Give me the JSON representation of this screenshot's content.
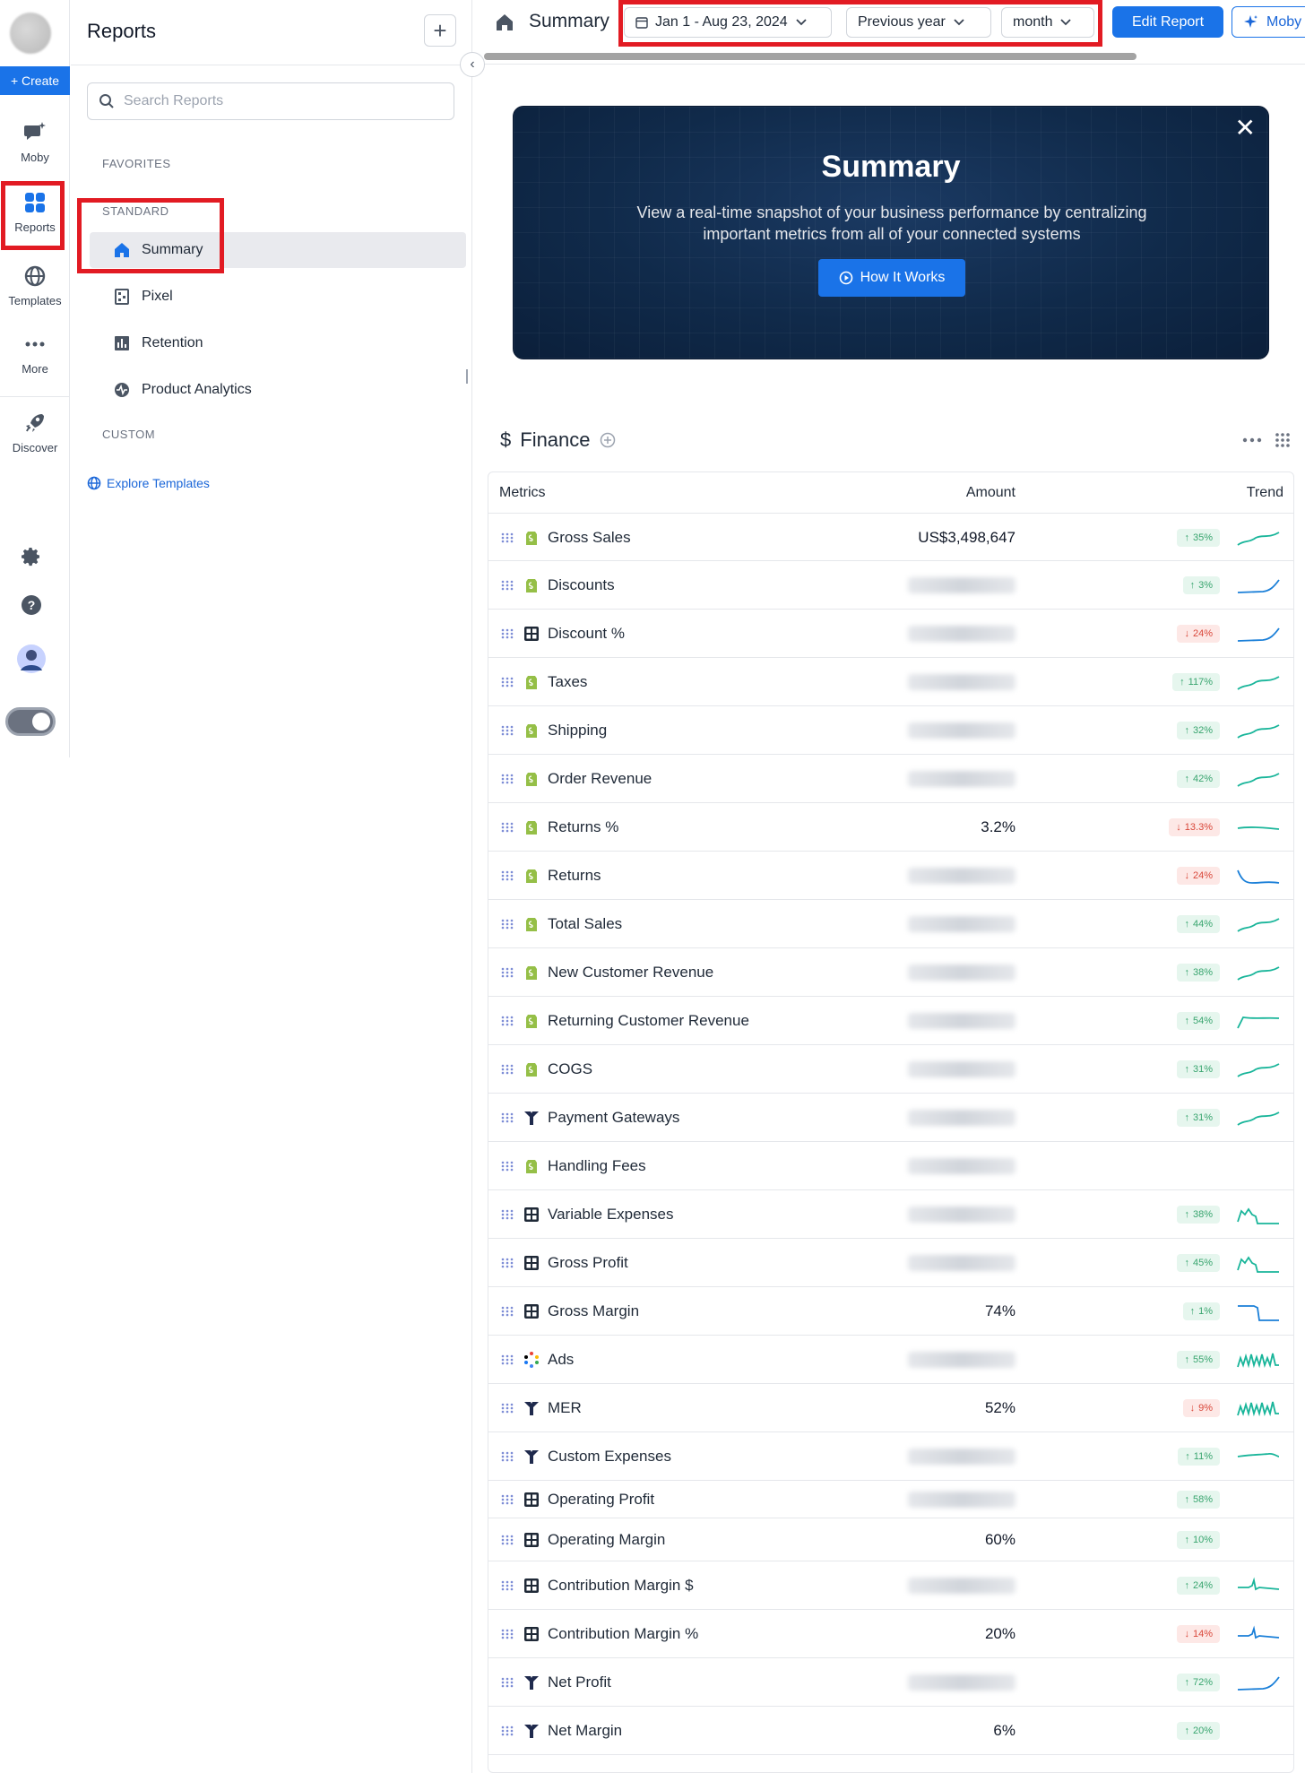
{
  "rail": {
    "create_label": "+ Create",
    "items": [
      {
        "label": "Moby",
        "icon": "moby-chat-icon"
      },
      {
        "label": "Reports",
        "icon": "reports-grid-icon"
      },
      {
        "label": "Templates",
        "icon": "globe-icon"
      },
      {
        "label": "More",
        "icon": "more-dots-icon"
      },
      {
        "label": "Discover",
        "icon": "rocket-icon"
      }
    ],
    "bottom_icons": [
      "settings-gear-icon",
      "help-icon",
      "user-avatar"
    ]
  },
  "panel": {
    "title": "Reports",
    "search_placeholder": "Search Reports",
    "favorites_label": "FAVORITES",
    "standard_label": "STANDARD",
    "custom_label": "CUSTOM",
    "items": [
      {
        "label": "Summary",
        "icon": "home-icon",
        "active": true
      },
      {
        "label": "Pixel",
        "icon": "pixel-icon",
        "active": false
      },
      {
        "label": "Retention",
        "icon": "bar-chart-icon",
        "active": false
      },
      {
        "label": "Product Analytics",
        "icon": "activity-icon",
        "active": false
      }
    ],
    "explore_label": "Explore Templates"
  },
  "header": {
    "title": "Summary",
    "date_range": "Jan 1 - Aug 23, 2024",
    "compare": "Previous year",
    "granularity": "month",
    "edit_label": "Edit Report",
    "moby_label": "Moby"
  },
  "banner": {
    "title": "Summary",
    "text": "View a real-time snapshot of your business performance by centralizing important metrics from all of your connected systems",
    "button_label": "How It Works"
  },
  "finance": {
    "title": "Finance",
    "columns": {
      "metrics": "Metrics",
      "amount": "Amount",
      "trend": "Trend"
    },
    "rows": [
      {
        "name": "Gross Sales",
        "source": "shopify",
        "amount": "US$3,498,647",
        "change": "35%",
        "dir": "up",
        "trend": "up-wave",
        "color": "#19b59a"
      },
      {
        "name": "Discounts",
        "source": "shopify",
        "amount": "",
        "change": "3%",
        "dir": "up",
        "trend": "rise-end",
        "color": "#1a7fd8"
      },
      {
        "name": "Discount %",
        "source": "calc",
        "amount": "",
        "change": "24%",
        "dir": "down",
        "trend": "rise-end",
        "color": "#1a7fd8"
      },
      {
        "name": "Taxes",
        "source": "shopify",
        "amount": "",
        "change": "117%",
        "dir": "up",
        "trend": "up-wave",
        "color": "#19b59a"
      },
      {
        "name": "Shipping",
        "source": "shopify",
        "amount": "",
        "change": "32%",
        "dir": "up",
        "trend": "up-wave",
        "color": "#19b59a"
      },
      {
        "name": "Order Revenue",
        "source": "shopify",
        "amount": "",
        "change": "42%",
        "dir": "up",
        "trend": "up-wave",
        "color": "#19b59a"
      },
      {
        "name": "Returns %",
        "source": "shopify",
        "amount": "3.2%",
        "change": "13.3%",
        "dir": "down",
        "trend": "flat",
        "color": "#19b59a"
      },
      {
        "name": "Returns",
        "source": "shopify",
        "amount": "",
        "change": "24%",
        "dir": "down",
        "trend": "drop",
        "color": "#1a7fd8"
      },
      {
        "name": "Total Sales",
        "source": "shopify",
        "amount": "",
        "change": "44%",
        "dir": "up",
        "trend": "up-wave",
        "color": "#19b59a"
      },
      {
        "name": "New Customer Revenue",
        "source": "shopify",
        "amount": "",
        "change": "38%",
        "dir": "up",
        "trend": "up-wave",
        "color": "#19b59a"
      },
      {
        "name": "Returning Customer Revenue",
        "source": "shopify",
        "amount": "",
        "change": "54%",
        "dir": "up",
        "trend": "jump-flat",
        "color": "#19b59a"
      },
      {
        "name": "COGS",
        "source": "shopify",
        "amount": "",
        "change": "31%",
        "dir": "up",
        "trend": "up-wave",
        "color": "#19b59a"
      },
      {
        "name": "Payment Gateways",
        "source": "triple",
        "amount": "",
        "change": "31%",
        "dir": "up",
        "trend": "up-wave",
        "color": "#19b59a"
      },
      {
        "name": "Handling Fees",
        "source": "shopify",
        "amount": "",
        "change": "",
        "dir": "",
        "trend": "",
        "color": ""
      },
      {
        "name": "Variable Expenses",
        "source": "calc",
        "amount": "",
        "change": "38%",
        "dir": "up",
        "trend": "spike-drop",
        "color": "#19b59a"
      },
      {
        "name": "Gross Profit",
        "source": "calc",
        "amount": "",
        "change": "45%",
        "dir": "up",
        "trend": "spike-drop",
        "color": "#19b59a"
      },
      {
        "name": "Gross Margin",
        "source": "calc",
        "amount": "74%",
        "change": "1%",
        "dir": "up",
        "trend": "step-drop",
        "color": "#1a7fd8"
      },
      {
        "name": "Ads",
        "source": "ads",
        "amount": "",
        "change": "55%",
        "dir": "up",
        "trend": "zigzag",
        "color": "#19b59a"
      },
      {
        "name": "MER",
        "source": "triple",
        "amount": "52%",
        "change": "9%",
        "dir": "down",
        "trend": "zigzag",
        "color": "#19b59a"
      },
      {
        "name": "Custom Expenses",
        "source": "triple",
        "amount": "",
        "change": "11%",
        "dir": "up",
        "trend": "flat-bump",
        "color": "#19b59a"
      },
      {
        "name": "Operating Profit",
        "source": "calc",
        "amount": "",
        "change": "58%",
        "dir": "up",
        "trend": "",
        "color": ""
      },
      {
        "name": "Operating Margin",
        "source": "calc",
        "amount": "60%",
        "change": "10%",
        "dir": "up",
        "trend": "",
        "color": ""
      },
      {
        "name": "Contribution Margin $",
        "source": "calc",
        "amount": "",
        "change": "24%",
        "dir": "up",
        "trend": "spike-mid",
        "color": "#19b59a"
      },
      {
        "name": "Contribution Margin %",
        "source": "calc",
        "amount": "20%",
        "change": "14%",
        "dir": "down",
        "trend": "spike-mid",
        "color": "#1a7fd8"
      },
      {
        "name": "Net Profit",
        "source": "triple",
        "amount": "",
        "change": "72%",
        "dir": "up",
        "trend": "rise-end",
        "color": "#1a7fd8"
      },
      {
        "name": "Net Margin",
        "source": "triple",
        "amount": "6%",
        "change": "20%",
        "dir": "up",
        "trend": "",
        "color": ""
      }
    ]
  },
  "colors": {
    "accent": "#1a73e8",
    "highlight": "#e21b23",
    "up": "#39a56f",
    "down": "#d9473a"
  }
}
